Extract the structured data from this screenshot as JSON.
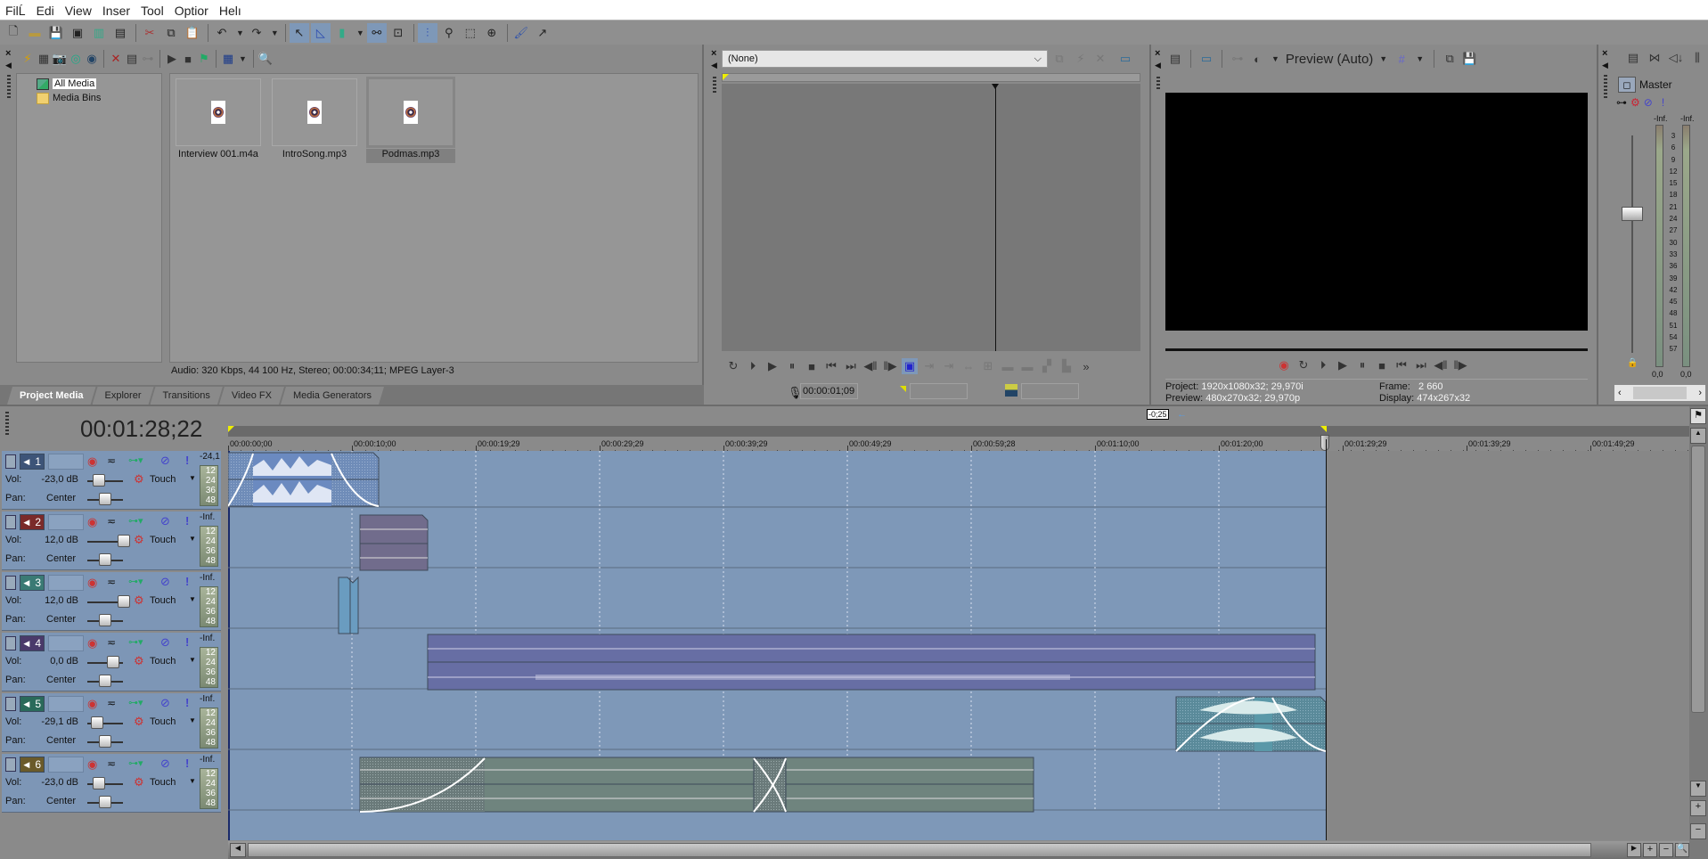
{
  "menu": [
    "File",
    "Edit",
    "View",
    "Insert",
    "Tools",
    "Options",
    "Help"
  ],
  "menu_display": [
    "FilĹ",
    "Edi",
    "View",
    "Inser",
    "Tool",
    "Optior",
    "Helı"
  ],
  "toolbar_icons": [
    "new-icon",
    "open-icon",
    "save-icon",
    "save-as-icon",
    "render-icon",
    "properties-icon",
    "cut-icon",
    "copy-icon",
    "paste-icon",
    "undo-icon",
    "redo-icon",
    "normal-edit-tool-icon",
    "envelope-tool-icon",
    "snapping-icon",
    "auto-ripple-icon",
    "lock-envelopes-icon",
    "enable-snapping-icon",
    "auto-crossfade-icon",
    "selection-tool-icon"
  ],
  "project_media": {
    "tree": [
      {
        "label": "All Media",
        "selected": true
      },
      {
        "label": "Media Bins",
        "selected": false
      }
    ],
    "items": [
      {
        "label": "Interview 001.m4a",
        "selected": false
      },
      {
        "label": "IntroSong.mp3",
        "selected": false
      },
      {
        "label": "Podmas.mp3",
        "selected": true
      }
    ],
    "status": "Audio: 320 Kbps, 44 100 Hz, Stereo; 00:00:34;11; MPEG Layer-3",
    "tabs": [
      {
        "label": "Project Media",
        "active": true
      },
      {
        "label": "Explorer",
        "active": false
      },
      {
        "label": "Transitions",
        "active": false
      },
      {
        "label": "Video FX",
        "active": false
      },
      {
        "label": "Media Generators",
        "active": false
      }
    ]
  },
  "trimmer": {
    "source": "(None)",
    "time": "00:00:01;09"
  },
  "preview": {
    "mode": "Preview (Auto)",
    "project_label": "Project:",
    "project_value": "1920x1080x32; 29,970i",
    "preview_label": "Preview:",
    "preview_value": "480x270x32; 29,970p",
    "frame_label": "Frame:",
    "frame_value": "2 660",
    "display_label": "Display:",
    "display_value": "474x267x32"
  },
  "master": {
    "label": "Master",
    "peak_left": "-Inf.",
    "peak_right": "-Inf.",
    "scale": [
      "3",
      "6",
      "9",
      "12",
      "15",
      "18",
      "21",
      "24",
      "27",
      "30",
      "33",
      "36",
      "39",
      "42",
      "45",
      "48",
      "51",
      "54",
      "57"
    ],
    "value_left": "0,0",
    "value_right": "0,0"
  },
  "timeline": {
    "time_display": "00:01:28;22",
    "cursor_delta": "-0;25",
    "ruler": [
      "00:00:00;00",
      "00:00:10;00",
      "00:00:19;29",
      "00:00:29;29",
      "00:00:39;29",
      "00:00:49;29",
      "00:00:59;28",
      "00:01:10;00",
      "00:01:20;00",
      "00:01:29;29",
      "00:01:39;29",
      "00:01:49;29"
    ],
    "tracks": [
      {
        "num": "1",
        "color": "#3d5478",
        "vol": "-23,0 dB",
        "vol_pos": 0.08,
        "pan": "Center",
        "mode": "Touch",
        "peak": "-24,1"
      },
      {
        "num": "2",
        "color": "#7a2a2a",
        "vol": "12,0 dB",
        "vol_pos": 1.0,
        "pan": "Center",
        "mode": "Touch",
        "peak": "-Inf."
      },
      {
        "num": "3",
        "color": "#3a7a74",
        "vol": "12,0 dB",
        "vol_pos": 1.0,
        "pan": "Center",
        "mode": "Touch",
        "peak": "-Inf."
      },
      {
        "num": "4",
        "color": "#4a3a6a",
        "vol": "0,0 dB",
        "vol_pos": 0.6,
        "pan": "Center",
        "mode": "Touch",
        "peak": "-Inf."
      },
      {
        "num": "5",
        "color": "#2a6a5a",
        "vol": "-29,1 dB",
        "vol_pos": 0.0,
        "pan": "Center",
        "mode": "Touch",
        "peak": "-Inf."
      },
      {
        "num": "6",
        "color": "#6a5a2a",
        "vol": "-23,0 dB",
        "vol_pos": 0.08,
        "pan": "Center",
        "mode": "Touch",
        "peak": "-Inf."
      }
    ],
    "meter_scale": [
      "12",
      "24",
      "36",
      "48"
    ],
    "vol_label": "Vol:",
    "pan_label": "Pan:"
  }
}
